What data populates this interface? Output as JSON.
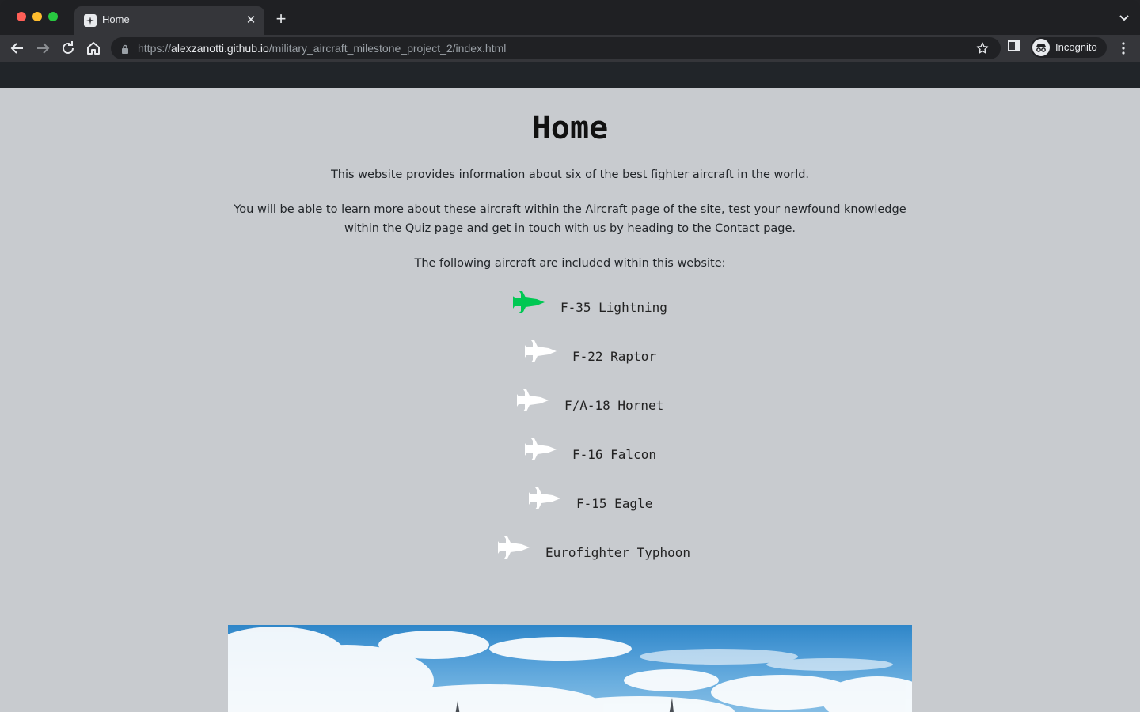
{
  "browser": {
    "tab_title": "Home",
    "tab_close_glyph": "✕",
    "new_tab_glyph": "+",
    "url_scheme": "https://",
    "url_host": "alexzanotti.github.io",
    "url_path": "/military_aircraft_milestone_project_2/index.html",
    "profile_label": "Incognito"
  },
  "page": {
    "title": "Home",
    "intro": "This website provides information about six of the best fighter aircraft in the world.",
    "details": "You will be able to learn more about these aircraft within the Aircraft page of the site, test your newfound knowledge within the Quiz page and get in touch with us by heading to the Contact page.",
    "list_intro": "The following aircraft are included within this website:",
    "aircraft": [
      {
        "name": "F-35 Lightning",
        "icon": "fighter-jet-icon",
        "highlighted": true
      },
      {
        "name": "F-22 Raptor",
        "icon": "fighter-jet-icon",
        "highlighted": false
      },
      {
        "name": "F/A-18 Hornet",
        "icon": "fighter-jet-icon",
        "highlighted": false
      },
      {
        "name": "F-16 Falcon",
        "icon": "fighter-jet-icon",
        "highlighted": false
      },
      {
        "name": "F-15 Eagle",
        "icon": "fighter-jet-icon",
        "highlighted": false
      },
      {
        "name": "Eurofighter Typhoon",
        "icon": "fighter-jet-icon",
        "highlighted": false
      }
    ]
  },
  "colors": {
    "page_bg": "#c8cbcf",
    "navbar_bg": "#212529",
    "icon_highlight": "#00c853",
    "icon_default": "#ffffff"
  }
}
